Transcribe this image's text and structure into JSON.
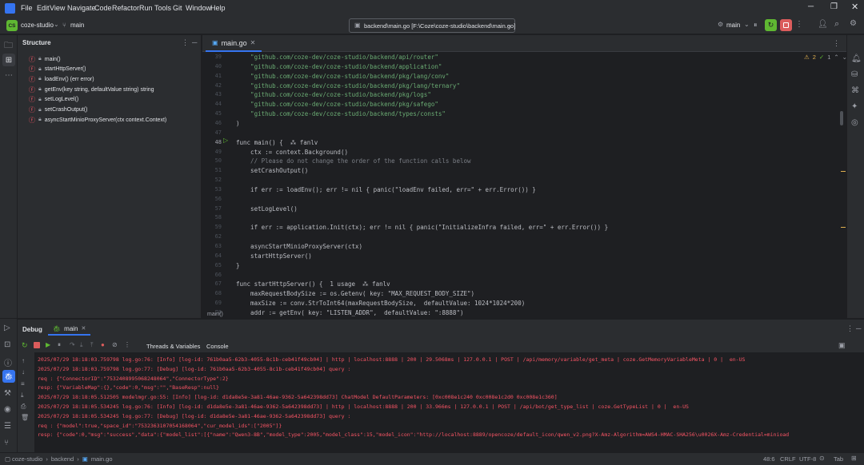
{
  "menu": [
    "File",
    "Edit",
    "View",
    "Navigate",
    "Code",
    "Refactor",
    "Run",
    "Tools",
    "Git",
    "Window",
    "Help"
  ],
  "project": {
    "badge": "CS",
    "name": "coze-studio",
    "branch": "main"
  },
  "filepath": "backend\\main.go [F:\\Coze\\coze-studio\\backend\\main.go]",
  "run_config": "main",
  "structure": {
    "title": "Structure",
    "items": [
      "main()",
      "startHttpServer()",
      "loadEnv() (err error)",
      "getEnv(key string, defaultValue string) string",
      "setLogLevel()",
      "setCrashOutput()",
      "asyncStartMinioProxyServer(ctx context.Context)"
    ]
  },
  "editor": {
    "tab": "main.go",
    "inspections": {
      "warnings": "2",
      "ok": "1"
    },
    "breadcrumb": "main()",
    "lines": [
      {
        "n": "39",
        "t": "    \"github.com/coze-dev/coze-studio/backend/api/router\""
      },
      {
        "n": "40",
        "t": "    \"github.com/coze-dev/coze-studio/backend/application\""
      },
      {
        "n": "41",
        "t": "    \"github.com/coze-dev/coze-studio/backend/pkg/lang/conv\""
      },
      {
        "n": "42",
        "t": "    \"github.com/coze-dev/coze-studio/backend/pkg/lang/ternary\""
      },
      {
        "n": "43",
        "t": "    \"github.com/coze-dev/coze-studio/backend/pkg/logs\""
      },
      {
        "n": "44",
        "t": "    \"github.com/coze-dev/coze-studio/backend/pkg/safego\""
      },
      {
        "n": "45",
        "t": "    \"github.com/coze-dev/coze-studio/backend/types/consts\""
      },
      {
        "n": "46",
        "t": ")"
      },
      {
        "n": "47",
        "t": ""
      },
      {
        "n": "48",
        "t": "func main() {  ⁂ fanlv"
      },
      {
        "n": "49",
        "t": "    ctx := context.Background()"
      },
      {
        "n": "50",
        "t": "    // Please do not change the order of the function calls below"
      },
      {
        "n": "51",
        "t": "    setCrashOutput()"
      },
      {
        "n": "52",
        "t": ""
      },
      {
        "n": "53",
        "t": "    if err := loadEnv(); err != nil { panic(\"loadEnv failed, err=\" + err.Error()) }"
      },
      {
        "n": "56",
        "t": ""
      },
      {
        "n": "57",
        "t": "    setLogLevel()"
      },
      {
        "n": "58",
        "t": ""
      },
      {
        "n": "59",
        "t": "    if err := application.Init(ctx); err != nil { panic(\"InitializeInfra failed, err=\" + err.Error()) }"
      },
      {
        "n": "62",
        "t": ""
      },
      {
        "n": "63",
        "t": "    asyncStartMinioProxyServer(ctx)"
      },
      {
        "n": "64",
        "t": "    startHttpServer()"
      },
      {
        "n": "65",
        "t": "}"
      },
      {
        "n": "66",
        "t": ""
      },
      {
        "n": "67",
        "t": "func startHttpServer() {  1 usage  ⁂ fanlv"
      },
      {
        "n": "68",
        "t": "    maxRequestBodySize := os.Getenv( key: \"MAX_REQUEST_BODY_SIZE\")"
      },
      {
        "n": "69",
        "t": "    maxSize := conv.StrToInt64(maxRequestBodySize,  defaultValue: 1024*1024*200)"
      },
      {
        "n": "70",
        "t": "    addr := getEnv( key: \"LISTEN_ADDR\",  defaultValue: \":8888\")"
      }
    ]
  },
  "debug": {
    "title": "Debug",
    "session": "main",
    "tabs": [
      "Threads & Variables",
      "Console"
    ],
    "console": [
      "2025/07/29 18:18:03.759798 log.go:76: [Info] [log-id: 761b0aa5-62b3-4055-8c1b-ceb41f49cb04] | http | localhost:8888 | 200 | 29.5068ms | 127.0.0.1 | POST | /api/memory/variable/get_meta | coze.GetMemoryVariableMeta | 0 |  en-US",
      "2025/07/29 18:18:03.759798 log.go:77: [Debug] [log-id: 761b0aa5-62b3-4055-8c1b-ceb41f49cb04] query :",
      "req : {\"ConnectorID\":\"7532408995068248064\",\"ConnectorType\":2}",
      "resp: {\"VariableMap\":{},\"code\":0,\"msg\":\"\",\"BaseResp\":null}",
      "2025/07/29 18:18:05.512505 modelmgr.go:55: [Info] [log-id: d1da8e5e-3a81-46ae-9362-5a642398dd73] ChatModel DefaultParameters: [0xc008e1c240 0xc008e1c2d0 0xc008e1c360]",
      "2025/07/29 18:18:05.534245 log.go:76: [Info] [log-id: d1da8e5e-3a81-46ae-9362-5a642398dd73] | http | localhost:8888 | 200 | 33.966ms | 127.0.0.1 | POST | /api/bot/get_type_list | coze.GetTypeList | 0 |  en-US",
      "2025/07/29 18:18:05.534245 log.go:77: [Debug] [log-id: d1da8e5e-3a81-46ae-9362-5a642398dd73] query :",
      "req : {\"model\":true,\"space_id\":\"7532363107054168064\",\"cur_model_ids\":[\"2005\"]}",
      "resp: {\"code\":0,\"msg\":\"success\",\"data\":{\"model_list\":[{\"name\":\"Qwen3-8B\",\"model_type\":2005,\"model_class\":15,\"model_icon\":\"http://localhost:8889/opencoze/default_icon/qwen_v2.png?X-Amz-Algorithm=AWS4-HMAC-SHA256\\u0026X-Amz-Credential=minioad"
    ]
  },
  "status": {
    "breadcrumb": [
      "coze-studio",
      "backend",
      "main.go"
    ],
    "position": "48:6",
    "line_sep": "CRLF",
    "encoding": "UTF-8",
    "indent": "Tab"
  }
}
